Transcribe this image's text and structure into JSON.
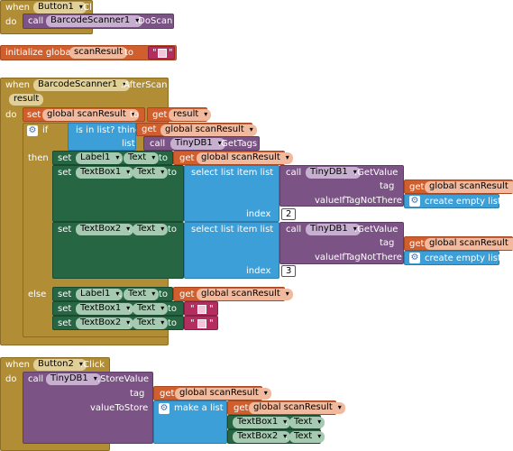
{
  "colors": {
    "control": "#b18e35",
    "component": "#7c5385",
    "variable": "#d05f2d",
    "list": "#3c9fd8",
    "text": "#b32d5e",
    "setter": "#266643",
    "math": "#3f71b5"
  },
  "kw": {
    "when": "when",
    "do": "do",
    "call": "call",
    "set": "set",
    "get": "get",
    "to": "to",
    "if": "if",
    "then": "then",
    "else": "else",
    "dot": ".",
    "tag": "tag",
    "index": "index",
    "list": "list",
    "init": "initialize global",
    "is_in_list": "is in list? thing",
    "select_item": "select list item  list",
    "value_if_not": "valueIfTagNotThere",
    "create_empty": "create empty list",
    "value_to_store": "valueToStore",
    "make_list": "make a list",
    "quote": "\""
  },
  "b1": {
    "component": "Button1",
    "event": ".Click",
    "call_component": "BarcodeScanner1",
    "call_method": ".DoScan"
  },
  "init": {
    "name": "scanResult"
  },
  "after": {
    "component": "BarcodeScanner1",
    "event": ".AfterScan",
    "param": "result",
    "global_var": "global scanResult",
    "result_var": "result",
    "tinydb": "TinyDB1",
    "get_tags": ".GetTags",
    "get_value": ".GetValue",
    "label": "Label1",
    "textbox1": "TextBox1",
    "textbox2": "TextBox2",
    "text_prop": "Text",
    "index1": "2",
    "index2": "3"
  },
  "b2": {
    "component": "Button2",
    "event": ".Click",
    "tinydb": "TinyDB1",
    "method": ".StoreValue",
    "global_var": "global scanResult",
    "textbox1": "TextBox1",
    "textbox2": "TextBox2",
    "text_prop": "Text"
  }
}
